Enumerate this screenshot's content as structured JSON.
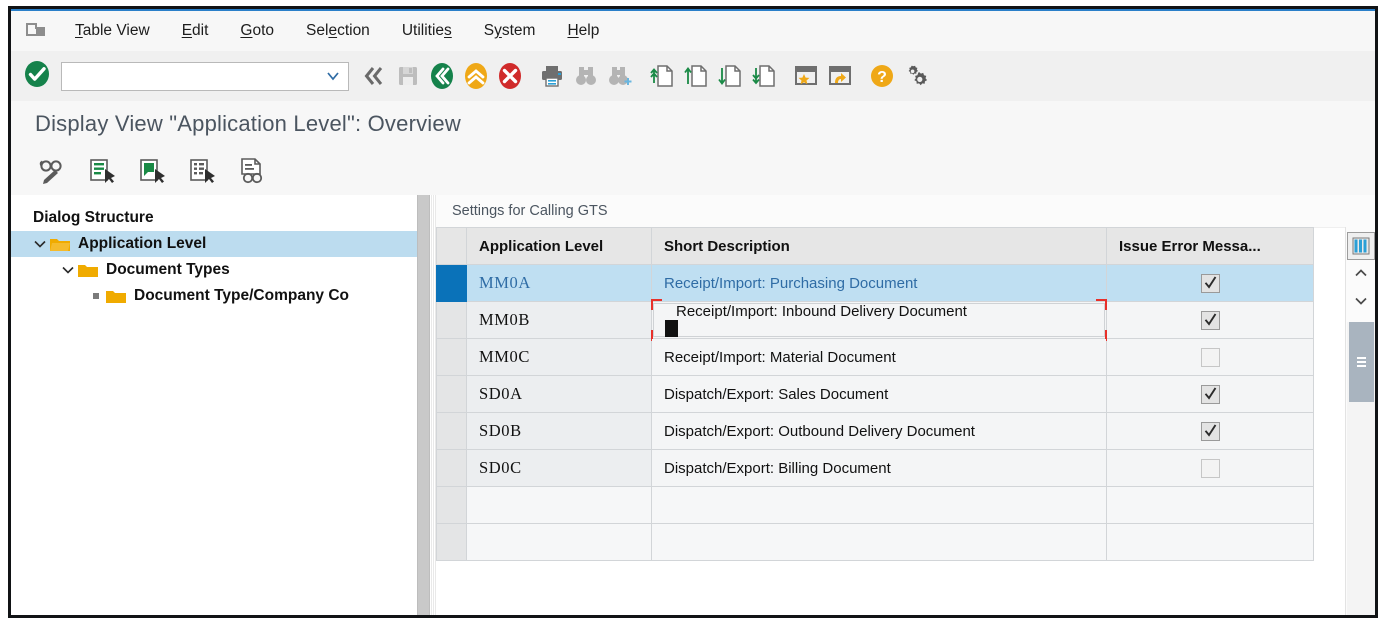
{
  "window": {
    "system_icon": "system-menu-icon"
  },
  "menubar": {
    "items": [
      {
        "name": "menu-table-view",
        "label": "Table View",
        "accel_index": 1
      },
      {
        "name": "menu-edit",
        "label": "Edit",
        "accel_index": 0
      },
      {
        "name": "menu-goto",
        "label": "Goto",
        "accel_index": 0
      },
      {
        "name": "menu-selection",
        "label": "Selection",
        "accel_index": 3
      },
      {
        "name": "menu-utilities",
        "label": "Utilities",
        "accel_index": 8
      },
      {
        "name": "menu-system",
        "label": "System",
        "accel_index": 1
      },
      {
        "name": "menu-help",
        "label": "Help",
        "accel_index": 0
      }
    ]
  },
  "toolbar": {
    "enter_label": "enter-ok-icon",
    "command_field": {
      "value": "",
      "placeholder": ""
    },
    "buttons": [
      {
        "name": "back-button",
        "icon": "back-chevrons-icon",
        "title": "Back"
      },
      {
        "name": "save-button",
        "icon": "save-floppy-icon",
        "title": "Save"
      },
      {
        "name": "exit-button",
        "icon": "green-back-circle-icon",
        "title": "Exit"
      },
      {
        "name": "up-button",
        "icon": "orange-up-circle-icon",
        "title": "Up"
      },
      {
        "name": "cancel-button",
        "icon": "red-cancel-circle-icon",
        "title": "Cancel"
      },
      {
        "name": "print-button",
        "icon": "printer-icon",
        "title": "Print"
      },
      {
        "name": "find-button",
        "icon": "binoculars-icon",
        "title": "Find"
      },
      {
        "name": "find-next-button",
        "icon": "binoculars-plus-icon",
        "title": "Find Next"
      },
      {
        "name": "first-page-button",
        "icon": "doc-up-double-icon",
        "title": "First Page"
      },
      {
        "name": "previous-page-button",
        "icon": "doc-up-icon",
        "title": "Previous Page"
      },
      {
        "name": "next-page-button",
        "icon": "doc-down-icon",
        "title": "Next Page"
      },
      {
        "name": "last-page-button",
        "icon": "doc-down-double-icon",
        "title": "Last Page"
      },
      {
        "name": "create-session-button",
        "icon": "window-star-icon",
        "title": "Create Session"
      },
      {
        "name": "shortcut-button",
        "icon": "window-arrow-icon",
        "title": "Create Shortcut"
      },
      {
        "name": "help-button",
        "icon": "help-question-icon",
        "title": "Help"
      },
      {
        "name": "customize-button",
        "icon": "gears-icon",
        "title": "Customize Local Layout"
      }
    ]
  },
  "page": {
    "title": "Display View \"Application Level\": Overview"
  },
  "apptoolbar": {
    "buttons": [
      {
        "name": "display-change-button",
        "icon": "glasses-pencil-icon",
        "title": "Display/Change"
      },
      {
        "name": "new-entries-button",
        "icon": "new-entries-icon",
        "title": "New Entries"
      },
      {
        "name": "copy-as-button",
        "icon": "copy-as-icon",
        "title": "Copy As"
      },
      {
        "name": "delete-button",
        "icon": "select-entries-icon",
        "title": "Delete"
      },
      {
        "name": "display-details-button",
        "icon": "document-glasses-icon",
        "title": "Display Details"
      }
    ]
  },
  "sidebar": {
    "title": "Dialog Structure",
    "items": [
      {
        "label": "Application Level",
        "level": 0,
        "expanded": true,
        "selected": true,
        "icon": "folder-open-icon"
      },
      {
        "label": "Document Types",
        "level": 1,
        "expanded": true,
        "selected": false,
        "icon": "folder-icon"
      },
      {
        "label": "Document Type/Company Co",
        "level": 2,
        "expanded": false,
        "selected": false,
        "icon": "folder-icon"
      }
    ]
  },
  "grid": {
    "caption": "Settings for Calling GTS",
    "columns": [
      {
        "key": "app_level",
        "label": "Application Level"
      },
      {
        "key": "short_description",
        "label": "Short Description"
      },
      {
        "key": "issue_error",
        "label": "Issue Error Messa..."
      }
    ],
    "rows": [
      {
        "app_level": "MM0A",
        "short_description": "Receipt/Import: Purchasing Document",
        "issue_error": true,
        "selected": true,
        "focused": false
      },
      {
        "app_level": "MM0B",
        "short_description": "Receipt/Import: Inbound Delivery Document",
        "issue_error": true,
        "selected": false,
        "focused": true
      },
      {
        "app_level": "MM0C",
        "short_description": "Receipt/Import: Material Document",
        "issue_error": false,
        "selected": false,
        "focused": false
      },
      {
        "app_level": "SD0A",
        "short_description": "Dispatch/Export: Sales Document",
        "issue_error": true,
        "selected": false,
        "focused": false
      },
      {
        "app_level": "SD0B",
        "short_description": "Dispatch/Export: Outbound Delivery Document",
        "issue_error": true,
        "selected": false,
        "focused": false
      },
      {
        "app_level": "SD0C",
        "short_description": "Dispatch/Export: Billing Document",
        "issue_error": false,
        "selected": false,
        "focused": false
      }
    ],
    "empty_rows": 2
  },
  "rail": {
    "config_icon": "column-config-icon",
    "scroll_up_icon": "chevron-up-icon",
    "scroll_down_icon": "chevron-down-icon",
    "thumb_grip_icon": "scrollbar-grip-icon"
  },
  "colors": {
    "accent_blue": "#0a72b9",
    "selected_row": "#bfdff2",
    "focus_red": "#e8302a",
    "folder_orange": "#f0ab00",
    "green": "#15824b",
    "amber": "#efa817",
    "red": "#d02b2b"
  }
}
